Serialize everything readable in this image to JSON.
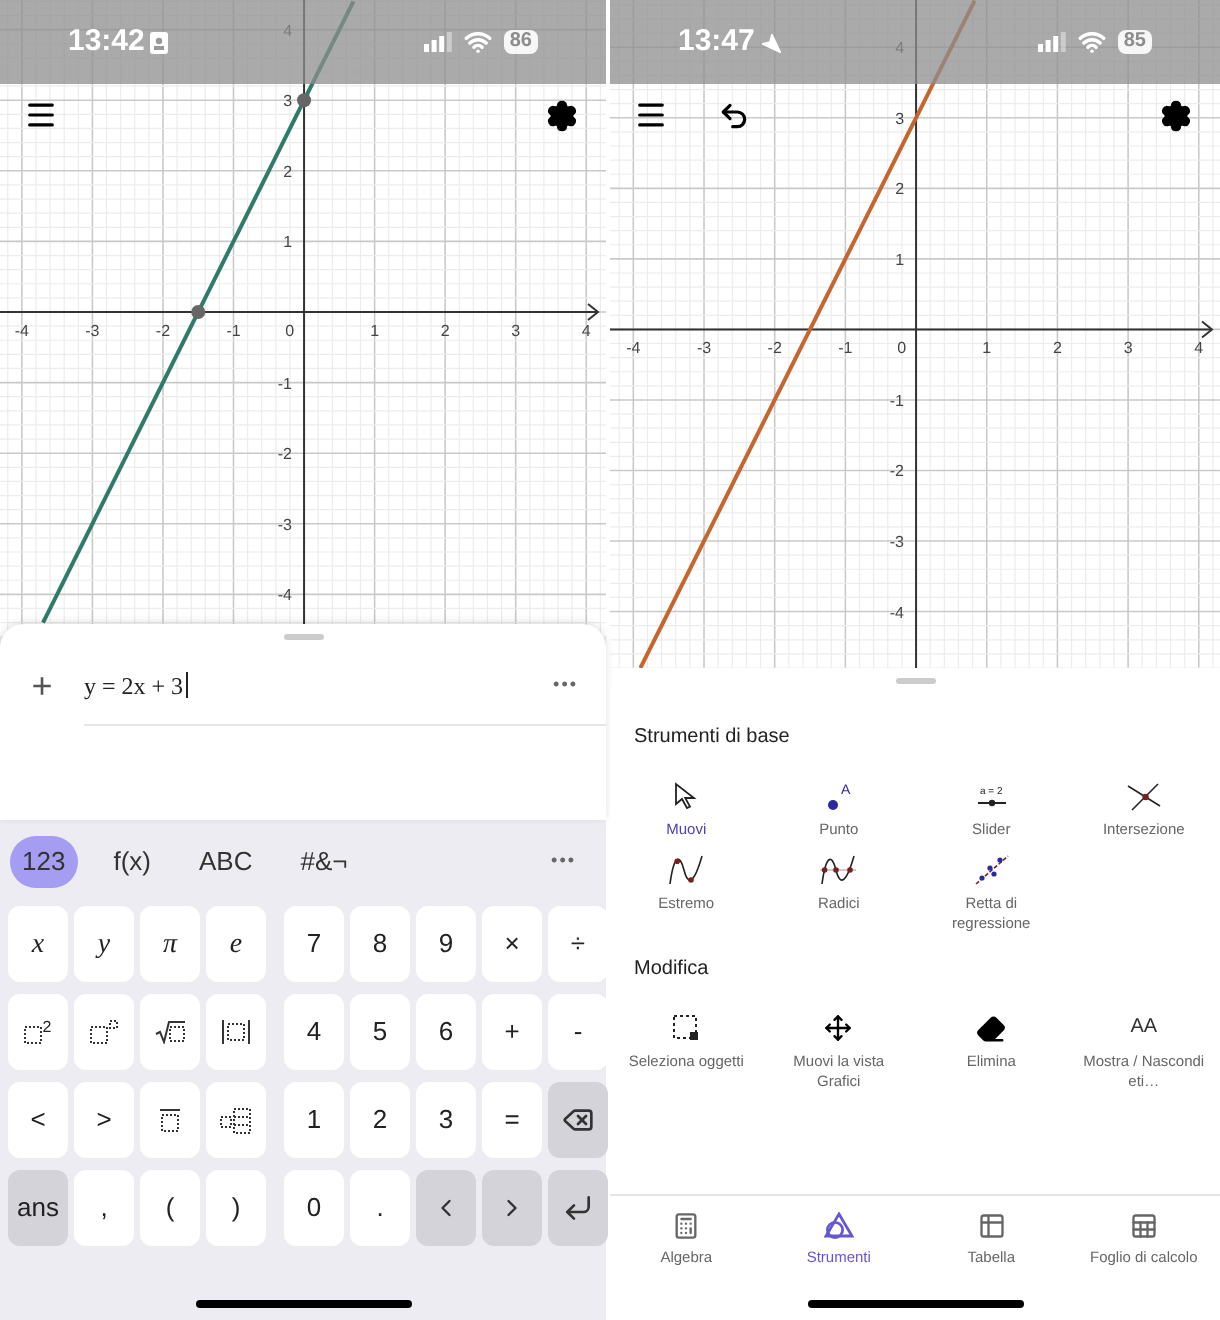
{
  "left": {
    "status_bar": {
      "time": "13:42",
      "focus_mode": true,
      "location_active": false,
      "battery": "86"
    },
    "toolbar": {
      "undo_button": false
    },
    "graph": {
      "origin_label": "0",
      "chart_data": {
        "type": "line",
        "grid": true,
        "xlim": [
          -4.31,
          4.28
        ],
        "ylim": [
          -4.59,
          4.42
        ],
        "xticks": [
          -4,
          -3,
          -2,
          -1,
          1,
          2,
          3,
          4
        ],
        "yticks": [
          -4,
          -3,
          -2,
          -1,
          1,
          2,
          3,
          4
        ],
        "series": [
          {
            "color": "#2f7a6a",
            "x": [
              -3.7,
              0.7
            ],
            "values": [
              -4.4,
              4.4
            ]
          }
        ]
      },
      "intercept_points": true
    },
    "algebra": {
      "add": "+",
      "input": "y = 2x + 3",
      "menu": "•••"
    },
    "keyboard": {
      "tabs": [
        {
          "label": "123",
          "selected": true
        },
        {
          "label": "f(x)",
          "selected": false
        },
        {
          "label": "ABC",
          "selected": false
        },
        {
          "label": "#&¬",
          "selected": false
        }
      ],
      "more": "•••",
      "rows": [
        [
          {
            "kind": "variable",
            "label": "x",
            "shaded": false
          },
          {
            "kind": "variable",
            "label": "y",
            "shaded": false
          },
          {
            "kind": "variable",
            "label": "π",
            "shaded": false
          },
          {
            "kind": "variable",
            "label": "e",
            "shaded": false
          },
          {
            "kind": "char",
            "label": "7",
            "shaded": false
          },
          {
            "kind": "char",
            "label": "8",
            "shaded": false
          },
          {
            "kind": "char",
            "label": "9",
            "shaded": false
          },
          {
            "kind": "char",
            "label": "×",
            "shaded": false
          },
          {
            "kind": "char",
            "label": "÷",
            "shaded": false
          }
        ],
        [
          {
            "kind": "squared",
            "label": "2",
            "shaded": false
          },
          {
            "kind": "power",
            "shaded": false
          },
          {
            "kind": "sqrt",
            "shaded": false
          },
          {
            "kind": "abs",
            "shaded": false
          },
          {
            "kind": "char",
            "label": "4",
            "shaded": false
          },
          {
            "kind": "char",
            "label": "5",
            "shaded": false
          },
          {
            "kind": "char",
            "label": "6",
            "shaded": false
          },
          {
            "kind": "char",
            "label": "+",
            "shaded": false
          },
          {
            "kind": "char",
            "label": "-",
            "shaded": false
          }
        ],
        [
          {
            "kind": "char",
            "label": "<",
            "shaded": false
          },
          {
            "kind": "char",
            "label": ">",
            "shaded": false
          },
          {
            "kind": "overline",
            "shaded": false
          },
          {
            "kind": "matrix",
            "shaded": false
          },
          {
            "kind": "char",
            "label": "1",
            "shaded": false
          },
          {
            "kind": "char",
            "label": "2",
            "shaded": false
          },
          {
            "kind": "char",
            "label": "3",
            "shaded": false
          },
          {
            "kind": "char",
            "label": "=",
            "shaded": false
          },
          {
            "kind": "backspace",
            "shaded": true
          }
        ],
        [
          {
            "kind": "char",
            "label": "ans",
            "shaded": true
          },
          {
            "kind": "char",
            "label": ",",
            "shaded": false
          },
          {
            "kind": "char",
            "label": "(",
            "shaded": false
          },
          {
            "kind": "char",
            "label": ")",
            "shaded": false
          },
          {
            "kind": "char",
            "label": "0",
            "shaded": false
          },
          {
            "kind": "char",
            "label": ".",
            "shaded": false
          },
          {
            "kind": "left",
            "shaded": true
          },
          {
            "kind": "right",
            "shaded": true
          },
          {
            "kind": "enter",
            "shaded": true
          }
        ]
      ]
    }
  },
  "right": {
    "status_bar": {
      "time": "13:47",
      "focus_mode": false,
      "location_active": true,
      "battery": "85"
    },
    "toolbar": {
      "undo_button": true
    },
    "graph": {
      "origin_label": "0",
      "chart_data": {
        "type": "line",
        "grid": true,
        "xlim": [
          -4.33,
          4.3
        ],
        "ylim": [
          -4.8,
          4.67
        ],
        "xticks": [
          -4,
          -3,
          -2,
          -1,
          1,
          2,
          3,
          4
        ],
        "yticks": [
          -4,
          -3,
          -2,
          -1,
          1,
          2,
          3,
          4
        ],
        "series": [
          {
            "color": "#c4662e",
            "x": [
              -3.9,
              0.83
            ],
            "values": [
              -4.8,
              4.66
            ]
          }
        ]
      }
    },
    "tools": [
      {
        "heading": "Strumenti di base",
        "items": [
          {
            "kind": "move",
            "label": "Muovi",
            "selected": true
          },
          {
            "kind": "point",
            "label": "Punto",
            "icon_text": "A",
            "selected": false
          },
          {
            "kind": "slider",
            "label": "Slider",
            "icon_text": "a = 2",
            "selected": false
          },
          {
            "kind": "intersect",
            "label": "Intersezione",
            "selected": false
          },
          {
            "kind": "extremum",
            "label": "Estremo",
            "selected": false
          },
          {
            "kind": "roots",
            "label": "Radici",
            "selected": false
          },
          {
            "kind": "regression",
            "label": "Retta di regressione",
            "selected": false
          }
        ]
      },
      {
        "heading": "Modifica",
        "items": [
          {
            "kind": "select",
            "label": "Seleziona oggetti",
            "selected": false
          },
          {
            "kind": "pan",
            "label": "Muovi la vista Grafici",
            "selected": false
          },
          {
            "kind": "erase",
            "label": "Elimina",
            "selected": false
          },
          {
            "kind": "labels",
            "label": "Mostra / Nascondi eti…",
            "icon_text": "AA",
            "selected": false
          }
        ]
      }
    ],
    "tabs": [
      {
        "kind": "algebra",
        "label": "Algebra",
        "selected": false
      },
      {
        "kind": "tools",
        "label": "Strumenti",
        "selected": true
      },
      {
        "kind": "table",
        "label": "Tabella",
        "selected": false
      },
      {
        "kind": "sheet",
        "label": "Foglio di calcolo",
        "selected": false
      }
    ]
  }
}
